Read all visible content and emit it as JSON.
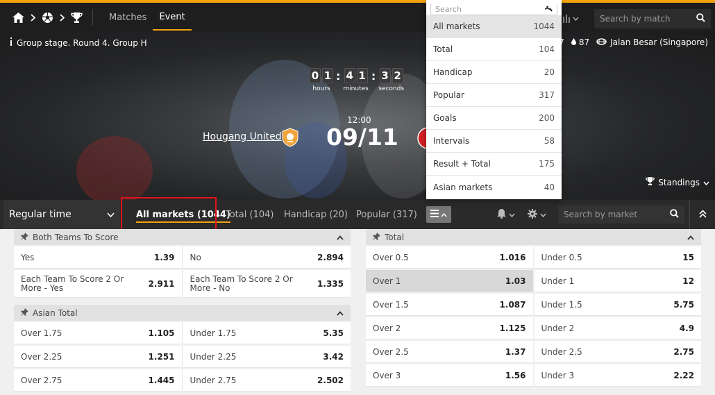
{
  "topnav": {
    "links": [
      "Matches",
      "Event"
    ],
    "search_placeholder": "Search by match"
  },
  "hero": {
    "stage": "Group stage. Round 4. Group H",
    "info_num1": "757",
    "info_num2": "87",
    "venue": "Jalan Besar (Singapore)",
    "countdown": {
      "h1": "0",
      "h2": "1",
      "m1": "4",
      "m2": "1",
      "s1": "3",
      "s2": "2",
      "hours_label": "hours",
      "minutes_label": "minutes",
      "seconds_label": "seconds"
    },
    "time": "12:00",
    "date": "09/11",
    "team1": "Hougang United",
    "standings": "Standings"
  },
  "market_bar": {
    "period": "Regular time",
    "tabs": [
      "All markets (1044)",
      "Total (104)",
      "Handicap (20)",
      "Popular (317)"
    ],
    "search_placeholder": "Search by market"
  },
  "dropdown": {
    "search_placeholder": "Search",
    "items": [
      {
        "label": "All markets",
        "count": "1044"
      },
      {
        "label": "Total",
        "count": "104"
      },
      {
        "label": "Handicap",
        "count": "20"
      },
      {
        "label": "Popular",
        "count": "317"
      },
      {
        "label": "Goals",
        "count": "200"
      },
      {
        "label": "Intervals",
        "count": "58"
      },
      {
        "label": "Result + Total",
        "count": "175"
      },
      {
        "label": "Asian markets",
        "count": "40"
      }
    ]
  },
  "groups": {
    "btts": {
      "title": "Both Teams To Score",
      "rows": [
        [
          {
            "label": "Yes",
            "odd": "1.39"
          },
          {
            "label": "No",
            "odd": "2.894"
          }
        ],
        [
          {
            "label": "Each Team To Score 2 Or More - Yes",
            "odd": "2.911"
          },
          {
            "label": "Each Team To Score 2 Or More - No",
            "odd": "1.335"
          }
        ]
      ]
    },
    "asian_total": {
      "title": "Asian Total",
      "rows": [
        [
          {
            "label": "Over 1.75",
            "odd": "1.105"
          },
          {
            "label": "Under 1.75",
            "odd": "5.35"
          }
        ],
        [
          {
            "label": "Over 2.25",
            "odd": "1.251"
          },
          {
            "label": "Under 2.25",
            "odd": "3.42"
          }
        ],
        [
          {
            "label": "Over 2.75",
            "odd": "1.445"
          },
          {
            "label": "Under 2.75",
            "odd": "2.502"
          }
        ]
      ]
    },
    "total": {
      "title": "Total",
      "rows": [
        [
          {
            "label": "Over 0.5",
            "odd": "1.016"
          },
          {
            "label": "Under 0.5",
            "odd": "15"
          }
        ],
        [
          {
            "label": "Over 1",
            "odd": "1.03"
          },
          {
            "label": "Under 1",
            "odd": "12"
          }
        ],
        [
          {
            "label": "Over 1.5",
            "odd": "1.087"
          },
          {
            "label": "Under 1.5",
            "odd": "5.75"
          }
        ],
        [
          {
            "label": "Over 2",
            "odd": "1.125"
          },
          {
            "label": "Under 2",
            "odd": "4.9"
          }
        ],
        [
          {
            "label": "Over 2.5",
            "odd": "1.37"
          },
          {
            "label": "Under 2.5",
            "odd": "2.75"
          }
        ],
        [
          {
            "label": "Over 3",
            "odd": "1.56"
          },
          {
            "label": "Under 3",
            "odd": "2.22"
          }
        ]
      ]
    }
  },
  "colors": {
    "accent": "#f3a20e",
    "highlight": "#e0141e"
  }
}
